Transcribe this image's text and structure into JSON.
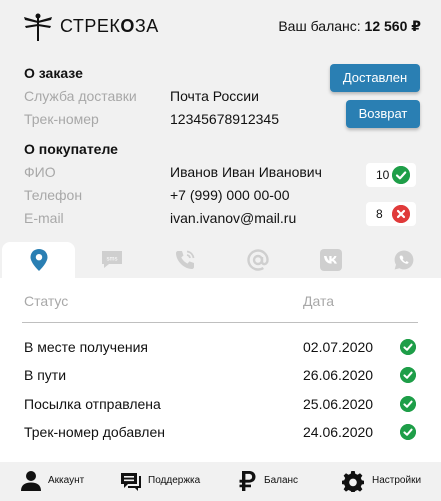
{
  "header": {
    "brand_light": "СТРЕК",
    "brand_bold": "О",
    "brand_tail": "ЗА",
    "balance_label": "Ваш баланс: ",
    "balance_value": "12 560 ₽"
  },
  "order": {
    "title": "О заказе",
    "service_label": "Служба доставки",
    "service_value": "Почта России",
    "track_label": "Трек-номер",
    "track_value": "12345678912345",
    "delivered_button": "Доставлен",
    "return_button": "Возврат"
  },
  "buyer": {
    "title": "О покупателе",
    "name_label": "ФИО",
    "name_value": "Иванов Иван Иванович",
    "phone_label": "Телефон",
    "phone_value": "+7 (999) 000 00-00",
    "email_label": "E-mail",
    "email_value": "ivan.ivanov@mail.ru",
    "phone_badge_count": "10",
    "email_badge_count": "8"
  },
  "tabs": [
    {
      "icon": "location-pin-icon",
      "active": true
    },
    {
      "icon": "sms-icon",
      "label": "sms"
    },
    {
      "icon": "phone-call-icon"
    },
    {
      "icon": "at-sign-icon"
    },
    {
      "icon": "vk-icon"
    },
    {
      "icon": "whatsapp-icon"
    }
  ],
  "table": {
    "col_status": "Статус",
    "col_date": "Дата",
    "rows": [
      {
        "status": "В месте получения",
        "date": "02.07.2020"
      },
      {
        "status": "В пути",
        "date": "26.06.2020"
      },
      {
        "status": "Посылка отправлена",
        "date": "25.06.2020"
      },
      {
        "status": "Трек-номер добавлен",
        "date": "24.06.2020"
      }
    ]
  },
  "nav": {
    "account": "Аккаунт",
    "support": "Поддержка",
    "balance": "Баланс",
    "settings": "Настройки"
  },
  "colors": {
    "accent": "#2a7fb3",
    "success": "#1e9e48",
    "error": "#e03a3a",
    "panel": "#f1f1f1",
    "muted": "#a8a8a8"
  }
}
